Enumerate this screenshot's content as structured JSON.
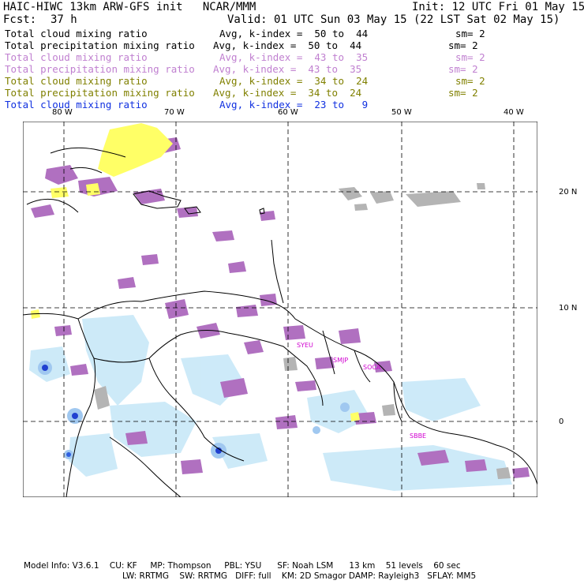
{
  "header": {
    "title": "HAIC-HIWC 13km ARW-GFS init   NCAR/MMM",
    "init": "Init: 12 UTC Fri 01 May 15",
    "fcst_label": "Fcst:",
    "fcst_value": "37 h",
    "valid": "Valid: 01 UTC Sun 03 May 15 (22 LST Sat 02 May 15)"
  },
  "legend": [
    {
      "label": "Total cloud mixing ratio",
      "avg": "Avg, k-index =  50 to  44",
      "sm": "sm= 2",
      "color": "#000000"
    },
    {
      "label": "Total precipitation mixing ratio",
      "avg": "Avg, k-index =  50 to  44",
      "sm": "sm= 2",
      "color": "#000000"
    },
    {
      "label": "Total cloud mixing ratio",
      "avg": "Avg, k-index =  43 to  35",
      "sm": "sm= 2",
      "color": "#c080d0"
    },
    {
      "label": "Total precipitation mixing ratio",
      "avg": "Avg, k-index =  43 to  35",
      "sm": "sm= 2",
      "color": "#c080d0"
    },
    {
      "label": "Total cloud mixing ratio",
      "avg": "Avg, k-index =  34 to  24",
      "sm": "sm= 2",
      "color": "#808000"
    },
    {
      "label": "Total precipitation mixing ratio",
      "avg": "Avg, k-index =  34 to  24",
      "sm": "sm= 2",
      "color": "#808000"
    },
    {
      "label": "Total cloud mixing ratio",
      "avg": "Avg, k-index =  23 to   9",
      "sm": "",
      "color": "#1030e0"
    }
  ],
  "map": {
    "lon_labels": [
      "80 W",
      "70 W",
      "60 W",
      "50 W",
      "40 W"
    ],
    "lat_labels": [
      "20 N",
      "10 N",
      "0"
    ],
    "stations": [
      "SYEU",
      "SMJP",
      "SOCA",
      "SBBE"
    ],
    "colors": {
      "gray": "#b4b4b4",
      "purple": "#b070c0",
      "yellow": "#ffff66",
      "lightblue": "#c8e8f8",
      "blue": "#2040d0",
      "olive": "#8a8a20"
    }
  },
  "footer": {
    "line1": "Model Info: V3.6.1    CU: KF     MP: Thompson     PBL: YSU      SF: Noah LSM      13 km    51 levels    60 sec",
    "line2": "LW: RRTMG    SW: RRTMG   DIFF: full    KM: 2D Smagor DAMP: Rayleigh3   SFLAY: MM5"
  }
}
